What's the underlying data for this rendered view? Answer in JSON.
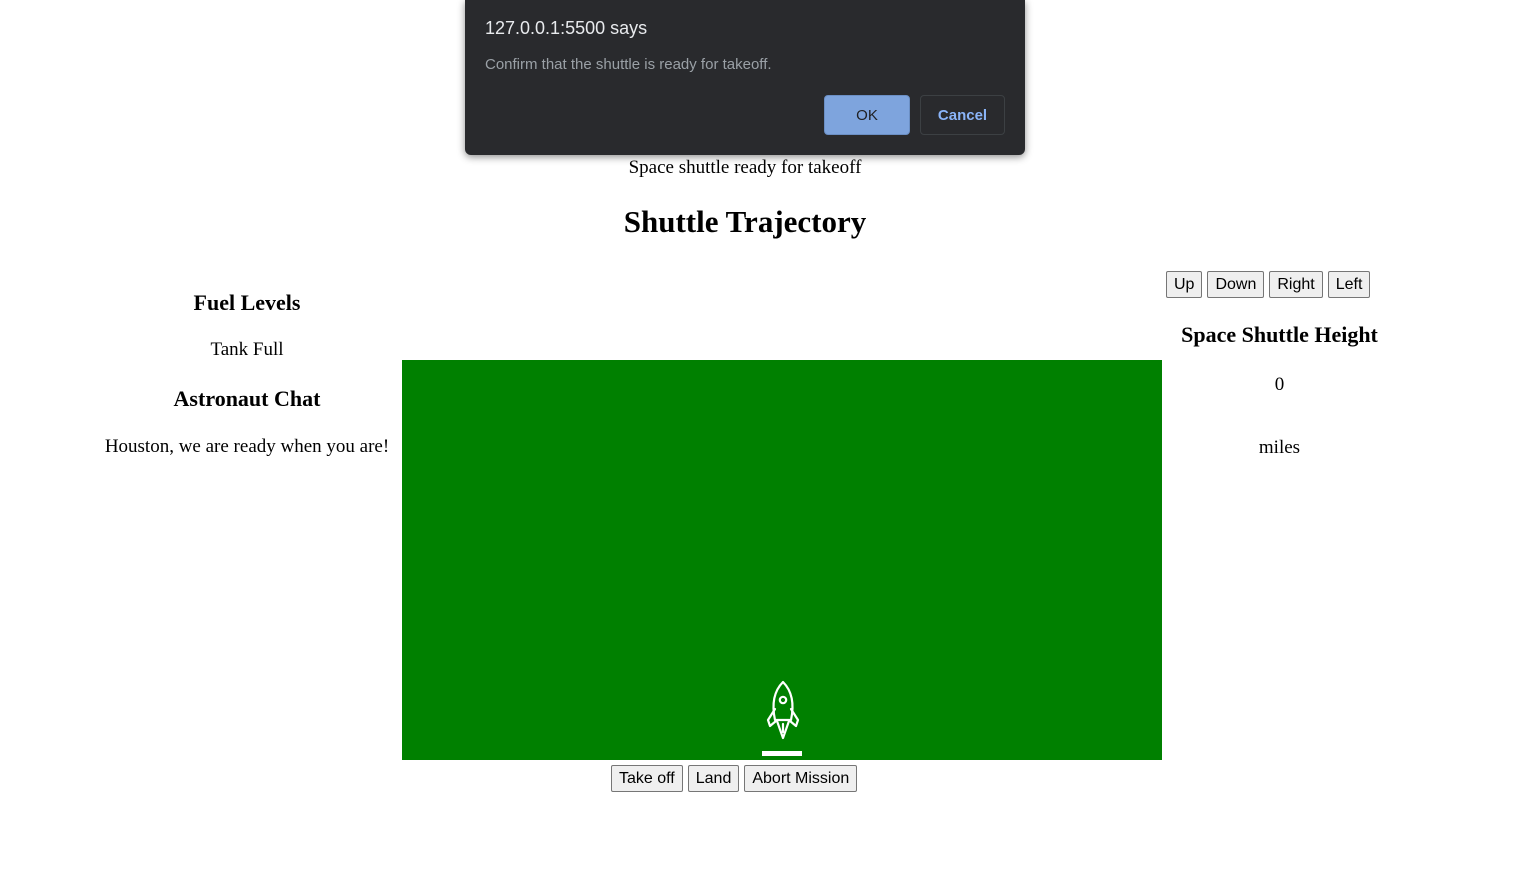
{
  "status_text": "Space shuttle ready for takeoff",
  "page_title": "Shuttle Trajectory",
  "left_panel": {
    "fuel_title": "Fuel Levels",
    "fuel_status": "Tank Full",
    "chat_title": "Astronaut Chat",
    "chat_message": "Houston, we are ready when you are!"
  },
  "controls": {
    "up": "Up",
    "down": "Down",
    "right": "Right",
    "left": "Left"
  },
  "right_panel": {
    "height_title": "Space Shuttle Height",
    "height_value": "0",
    "height_unit": "miles"
  },
  "bottom_controls": {
    "take_off": "Take off",
    "land": "Land",
    "abort": "Abort Mission"
  },
  "field": {
    "background_color": "#008000",
    "icon": "rocket-icon"
  },
  "dialog": {
    "title": "127.0.0.1:5500 says",
    "message": "Confirm that the shuttle is ready for takeoff.",
    "ok_label": "OK",
    "cancel_label": "Cancel"
  }
}
